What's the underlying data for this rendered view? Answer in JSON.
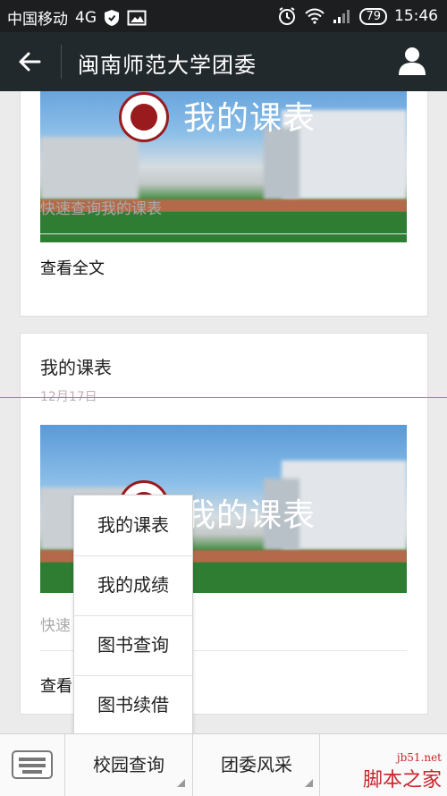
{
  "status_bar": {
    "carrier": "中国移动",
    "network": "4G",
    "battery": "79",
    "time": "15:46"
  },
  "header": {
    "title": "闽南师范大学团委"
  },
  "articles": [
    {
      "banner_text": "我的课表",
      "summary": "快速查询我的课表",
      "read_all": "查看全文"
    },
    {
      "title": "我的课表",
      "date": "12月17日",
      "banner_text": "我的课表",
      "summary": "快速",
      "read_all": "查看"
    }
  ],
  "popup_menu": {
    "items": [
      "我的课表",
      "我的成绩",
      "图书查询",
      "图书续借"
    ]
  },
  "bottom_bar": {
    "tabs": [
      "校园查询",
      "团委风采"
    ]
  },
  "watermark": {
    "line1": "jb51.net",
    "line2": "脚本之家"
  },
  "colors": {
    "title_bar": "#22292c",
    "seal_red": "#9a1b1e",
    "watermark_red": "#c9252a"
  }
}
